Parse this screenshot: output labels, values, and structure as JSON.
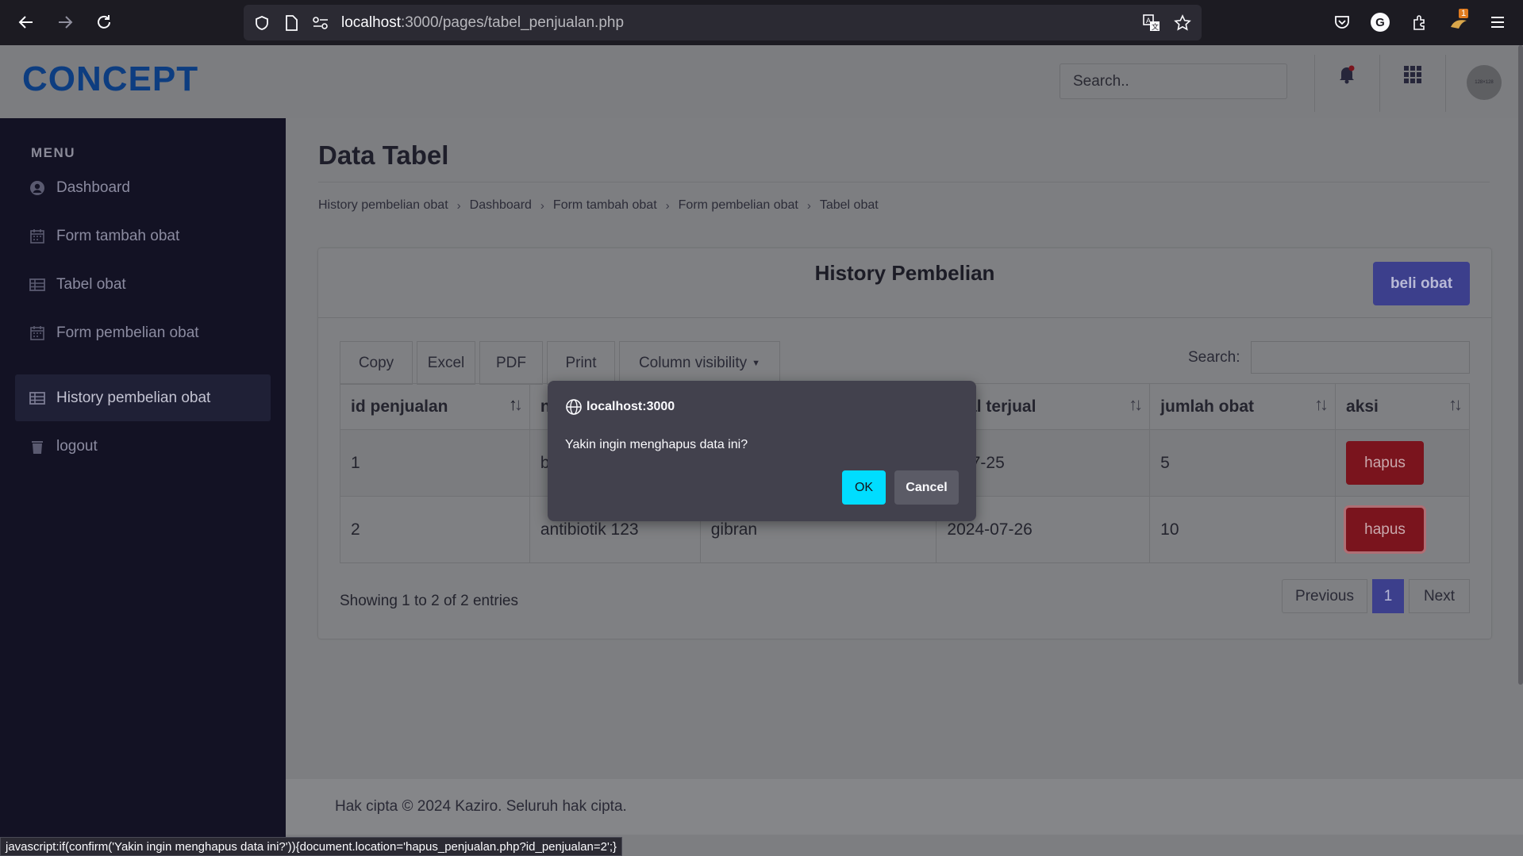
{
  "browser": {
    "url_host": "localhost",
    "url_path": ":3000/pages/tabel_penjualan.php",
    "extension_badge": "1",
    "account_initial": "G",
    "status_text": "javascript:if(confirm('Yakin ingin menghapus data ini?')){document.location='hapus_penjualan.php?id_penjualan=2';}"
  },
  "header": {
    "logo": "CONCEPT",
    "search_placeholder": "Search..",
    "avatar_text": "128×128"
  },
  "sidebar": {
    "title": "MENU",
    "items": [
      {
        "label": "Dashboard",
        "icon": "user-circle-icon"
      },
      {
        "label": "Form tambah obat",
        "icon": "calendar-icon"
      },
      {
        "label": "Tabel obat",
        "icon": "table-icon"
      },
      {
        "label": "Form pembelian obat",
        "icon": "calendar-icon"
      },
      {
        "label": "History pembelian obat",
        "icon": "table-icon",
        "active": true
      },
      {
        "label": "logout",
        "icon": "trash-icon"
      }
    ]
  },
  "main": {
    "title": "Data Tabel",
    "breadcrumbs": [
      "History pembelian obat",
      "Dashboard",
      "Form tambah obat",
      "Form pembelian obat",
      "Tabel obat"
    ],
    "card_title": "History Pembelian",
    "beli_label": "beli obat",
    "buttons": {
      "copy": "Copy",
      "excel": "Excel",
      "pdf": "PDF",
      "print": "Print",
      "colvis": "Column visibility"
    },
    "search_label": "Search:",
    "columns": [
      "id penjualan",
      "n",
      "",
      "ggal terjual",
      "jumlah obat",
      "aksi"
    ],
    "rows": [
      {
        "id": "1",
        "nama": "b",
        "pembeli": "",
        "tanggal": "4-07-25",
        "jumlah": "5",
        "aksi": "hapus"
      },
      {
        "id": "2",
        "nama": "antibiotik 123",
        "pembeli": "gibran",
        "tanggal": "2024-07-26",
        "jumlah": "10",
        "aksi": "hapus"
      }
    ],
    "entries_info": "Showing 1 to 2 of 2 entries",
    "pagination": {
      "previous": "Previous",
      "current": "1",
      "next": "Next"
    }
  },
  "footer": {
    "text": "Hak cipta © 2024 Kaziro. Seluruh hak cipta."
  },
  "dialog": {
    "origin": "localhost:3000",
    "message": "Yakin ingin menghapus data ini?",
    "ok": "OK",
    "cancel": "Cancel"
  }
}
